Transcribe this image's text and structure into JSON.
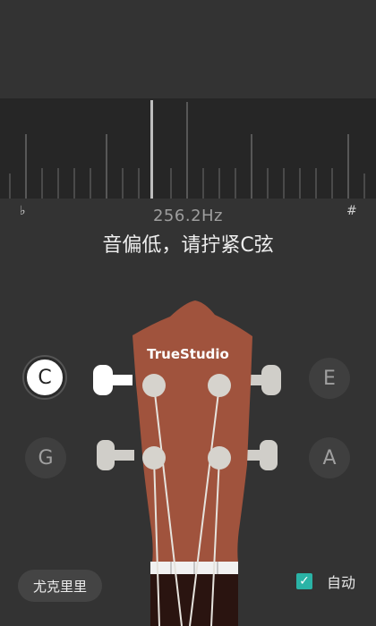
{
  "meter": {
    "flat_symbol": "♭",
    "sharp_symbol": "#",
    "frequency": "256.2Hz",
    "message": "音偏低，请拧紧C弦"
  },
  "headstock": {
    "brand": "TrueStudio"
  },
  "strings": [
    {
      "key": "c",
      "label": "C",
      "active": true
    },
    {
      "key": "e",
      "label": "E",
      "active": false
    },
    {
      "key": "g",
      "label": "G",
      "active": false
    },
    {
      "key": "a",
      "label": "A",
      "active": false
    }
  ],
  "bottom": {
    "instrument_button": "尤克里里",
    "auto_label": "自动",
    "auto_checked": true
  },
  "colors": {
    "background": "#333333",
    "meter_bg": "#262626",
    "headstock": "#a0533d",
    "accent": "#2ab3a6",
    "fretboard": "#2a1410"
  }
}
